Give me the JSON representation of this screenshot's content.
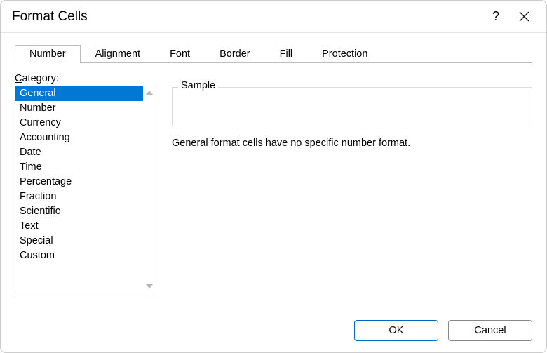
{
  "dialog": {
    "title": "Format Cells"
  },
  "tabs": {
    "number": "Number",
    "alignment": "Alignment",
    "font": "Font",
    "border": "Border",
    "fill": "Fill",
    "protection": "Protection"
  },
  "category": {
    "label_prefix": "C",
    "label_rest": "ategory:",
    "items": [
      "General",
      "Number",
      "Currency",
      "Accounting",
      "Date",
      "Time",
      "Percentage",
      "Fraction",
      "Scientific",
      "Text",
      "Special",
      "Custom"
    ],
    "selected_index": 0
  },
  "sample": {
    "legend": "Sample",
    "value": ""
  },
  "description": "General format cells have no specific number format.",
  "buttons": {
    "ok": "OK",
    "cancel": "Cancel"
  }
}
